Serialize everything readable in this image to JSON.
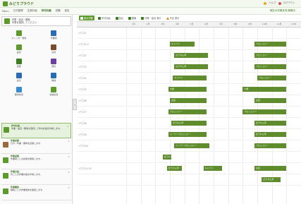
{
  "app": {
    "title": "みどりプラウド",
    "right_items": [
      "ヘルプ",
      "ログアウト"
    ]
  },
  "menubar": {
    "items": [
      "Menu",
      "日次管理",
      "生産計画",
      "作付計画",
      "試験",
      "設定"
    ],
    "status": "現在の作業状況:稼働中"
  },
  "sidebar": {
    "category": {
      "line1": "作業・品目・圃場",
      "line2": "作業を選択してください"
    },
    "tools": [
      {
        "label": "カレンダー登録",
        "icon": "calendar-icon",
        "color": "#5c9a2b"
      },
      {
        "label": "作業者",
        "icon": "person-icon",
        "color": "#2a6bb8"
      },
      {
        "label": "品目",
        "icon": "sprout-icon",
        "color": "#5c9a2b"
      },
      {
        "label": "資材",
        "icon": "bag-icon",
        "color": "#7a4b2a"
      },
      {
        "label": "農薬",
        "icon": "bottle-icon",
        "color": "#3b7d1f"
      },
      {
        "label": "肥料",
        "icon": "fertilizer-icon",
        "color": "#6b3fa0"
      },
      {
        "label": "設定",
        "icon": "gear-icon",
        "color": "#2a6bb8"
      },
      {
        "label": "機械",
        "icon": "machine-icon",
        "color": "#2a6bb8"
      },
      {
        "label": "圃場情報",
        "icon": "field-icon",
        "color": "#3a8ad1"
      },
      {
        "label": "収穫記録",
        "icon": "leaf-icon",
        "color": "#5c9a2b"
      }
    ],
    "list": [
      {
        "head": "作付計画",
        "body": "作業・品目・圃場を選択して作付計画を作成します。",
        "tile": "green",
        "selected": true
      },
      {
        "head": "作業記録",
        "body": "日付・作業・圃場を記録します。",
        "tile": "brown",
        "selected": false
      },
      {
        "head": "作業記録",
        "body": "作業者ごとの記録を確認します。",
        "tile": "green",
        "selected": false
      },
      {
        "head": "作業計画",
        "body": "月ごとの作業計画を作成します。",
        "tile": "green",
        "selected": false
      },
      {
        "head": "作業報告",
        "body": "圃場ごとの作業報告を確認します。",
        "tile": "green",
        "selected": false
      }
    ]
  },
  "toolbar": {
    "items": [
      {
        "label": "表示切替",
        "primary": true,
        "icon": "grid-icon"
      },
      {
        "label": "作付計画",
        "primary": false,
        "icon": "plan-icon"
      },
      {
        "label": "品目",
        "primary": false,
        "icon": "sprout-icon"
      },
      {
        "label": "圃場",
        "primary": false,
        "icon": "field-icon"
      },
      {
        "label": "作業・品目 表示",
        "primary": false,
        "icon": "list-icon"
      },
      {
        "label": "予定 表示",
        "primary": false,
        "icon": "warning-icon"
      }
    ]
  },
  "grid": {
    "columns": [
      "1月",
      "2月",
      "3月",
      "4月",
      "5月",
      "6月",
      "7月",
      "8月",
      "9月",
      "10月",
      "11月",
      "12月"
    ],
    "rows": [
      {
        "label": "ハウス1",
        "bars": []
      },
      {
        "label": "ハウス1-2",
        "bars": [
          {
            "text": "キャベツ",
            "start": 3.0,
            "len": 1.7
          },
          {
            "text": "ブロッコリー",
            "start": 8.8,
            "len": 2.2
          }
        ]
      },
      {
        "label": "ハウス2",
        "bars": [
          {
            "text": "ほうれん草",
            "start": 3.3,
            "len": 2.3
          },
          {
            "text": "ブロッコリー",
            "start": 8.8,
            "len": 2.2
          }
        ]
      },
      {
        "label": "ハウス3",
        "bars": [
          {
            "text": "ほうれん草",
            "start": 3.3,
            "len": 2.3
          },
          {
            "text": "ブロッコリー",
            "start": 8.8,
            "len": 2.2
          }
        ]
      },
      {
        "label": "ハウス4",
        "bars": [
          {
            "text": "キャベツ",
            "start": 3.2,
            "len": 2.3
          },
          {
            "text": "ブロッコリー",
            "start": 9.0,
            "len": 2.0
          }
        ]
      },
      {
        "label": "ハウス5",
        "bars": [
          {
            "text": "大根",
            "start": 2.9,
            "len": 2.6
          },
          {
            "text": "大根",
            "start": 8.0,
            "len": 3.0
          }
        ]
      },
      {
        "label": "ハウス6",
        "bars": [
          {
            "text": "白菜",
            "start": 3.0,
            "len": 2.5
          },
          {
            "text": "白菜",
            "start": 8.8,
            "len": 2.2
          }
        ]
      },
      {
        "label": "ハウス7",
        "bars": [
          {
            "text": "ブロッコリー",
            "start": 2.9,
            "len": 2.6
          },
          {
            "text": "ブロッコリー",
            "start": 8.0,
            "len": 3.0
          }
        ]
      },
      {
        "label": "ハウス8",
        "bars": [
          {
            "text": "ほうれん草",
            "start": 3.1,
            "len": 2.4
          },
          {
            "text": "ほうれん草",
            "start": 8.8,
            "len": 2.2
          }
        ]
      },
      {
        "label": "ハウス9",
        "bars": [
          {
            "text": "スーパーブロッコリー",
            "start": 2.9,
            "len": 2.6
          },
          {
            "text": "ほうれん草",
            "start": 8.8,
            "len": 2.2
          }
        ]
      },
      {
        "label": "ハウス10",
        "bars": [
          {
            "text": "スーパーブロッコリー",
            "start": 3.3,
            "len": 2.4
          },
          {
            "text": "ブロッコリー",
            "start": 8.8,
            "len": 2.2
          }
        ]
      },
      {
        "label": "",
        "bars": [
          {
            "text": "ほうれん",
            "start": 2.5,
            "len": 0.6
          }
        ]
      },
      {
        "label": "ハウス11-12",
        "bars": [
          {
            "text": "ほうれん草",
            "start": 2.8,
            "len": 1.0
          },
          {
            "text": "キャベツ",
            "start": 5.3,
            "len": 1.3
          },
          {
            "text": "白菜",
            "start": 8.8,
            "len": 2.2
          }
        ]
      },
      {
        "label": "",
        "bars": [
          {
            "text": "ほうれん草",
            "start": 9.3,
            "len": 1.3
          }
        ]
      }
    ]
  }
}
